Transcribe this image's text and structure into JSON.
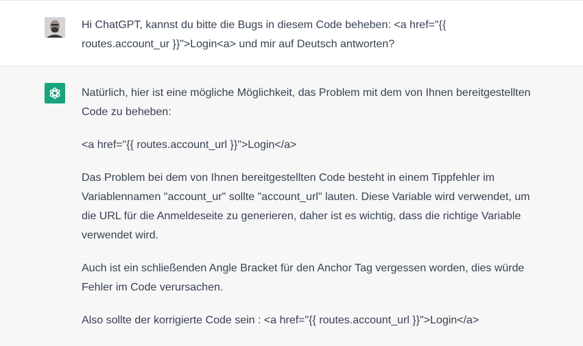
{
  "user_message": {
    "avatar": "user-avatar-photo",
    "text": "Hi ChatGPT, kannst du bitte die Bugs in diesem Code beheben: <a href=\"{{ routes.account_ur  }}\">Login<a> und mir auf Deutsch antworten?"
  },
  "assistant_message": {
    "avatar": "openai-logo-icon",
    "avatar_color": "#19a37f",
    "paragraphs": [
      "Natürlich, hier ist eine mögliche Möglichkeit, das Problem mit dem von Ihnen bereitgestellten Code zu beheben:",
      "<a href=\"{{ routes.account_url }}\">Login</a>",
      "Das Problem bei dem von Ihnen bereitgestellten Code besteht in einem Tippfehler im Variablennamen \"account_ur\" sollte \"account_url\" lauten. Diese Variable wird verwendet, um die URL für die Anmeldeseite zu generieren, daher ist es wichtig, dass die richtige Variable verwendet wird.",
      "Auch ist ein schließenden Angle Bracket für den Anchor Tag vergessen worden, dies würde Fehler im Code verursachen.",
      "Also sollte der korrigierte Code sein : <a href=\"{{ routes.account_url }}\">Login</a>"
    ]
  }
}
